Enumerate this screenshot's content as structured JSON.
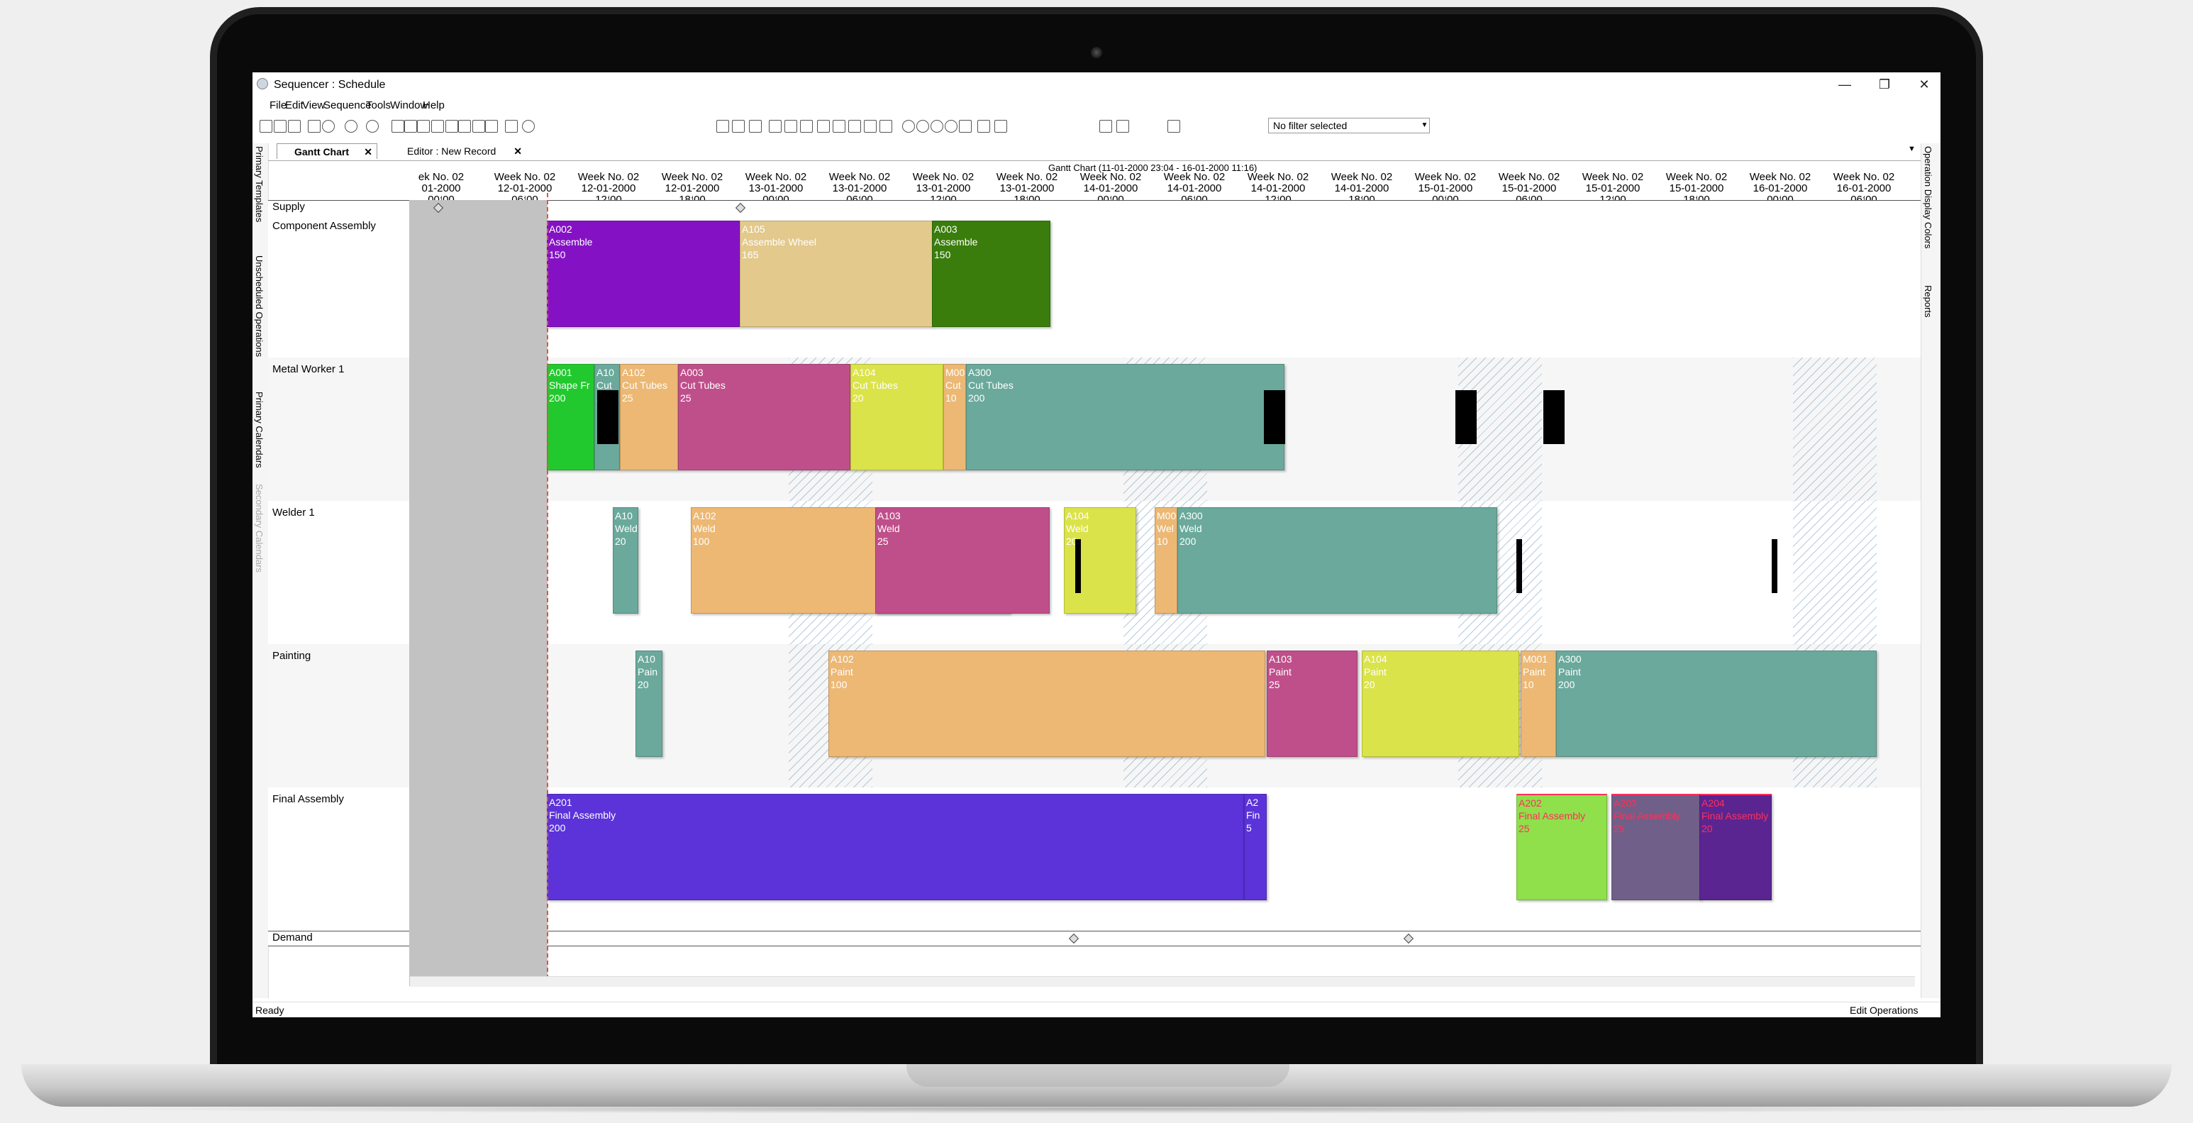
{
  "window": {
    "title": "Sequencer : Schedule",
    "min": "—",
    "max": "❐",
    "close": "✕"
  },
  "menu": [
    "File",
    "Edit",
    "View",
    "Sequence",
    "Tools",
    "Window",
    "Help"
  ],
  "toolbar": {
    "filter_value": "No filter selected"
  },
  "left_tabs": [
    "Primary Templates",
    "Unscheduled Operations",
    "Primary Calendars",
    "Secondary Calendars"
  ],
  "right_tabs": [
    "Operation Display Colors",
    "Reports"
  ],
  "doc_tabs": [
    {
      "label": "Gantt Chart",
      "active": true
    },
    {
      "label": "Editor : New Record",
      "active": false
    }
  ],
  "gantt": {
    "title": "Gantt Chart   (11-01-2000 23:04 - 16-01-2000 11:16)",
    "ticks": [
      {
        "week": "ek No. 02",
        "date": "01-2000",
        "time": "00:00"
      },
      {
        "week": "Week No. 02",
        "date": "12-01-2000",
        "time": "06:00"
      },
      {
        "week": "Week No. 02",
        "date": "12-01-2000",
        "time": "12:00"
      },
      {
        "week": "Week No. 02",
        "date": "12-01-2000",
        "time": "18:00"
      },
      {
        "week": "Week No. 02",
        "date": "13-01-2000",
        "time": "00:00"
      },
      {
        "week": "Week No. 02",
        "date": "13-01-2000",
        "time": "06:00"
      },
      {
        "week": "Week No. 02",
        "date": "13-01-2000",
        "time": "12:00"
      },
      {
        "week": "Week No. 02",
        "date": "13-01-2000",
        "time": "18:00"
      },
      {
        "week": "Week No. 02",
        "date": "14-01-2000",
        "time": "00:00"
      },
      {
        "week": "Week No. 02",
        "date": "14-01-2000",
        "time": "06:00"
      },
      {
        "week": "Week No. 02",
        "date": "14-01-2000",
        "time": "12:00"
      },
      {
        "week": "Week No. 02",
        "date": "14-01-2000",
        "time": "18:00"
      },
      {
        "week": "Week No. 02",
        "date": "15-01-2000",
        "time": "00:00"
      },
      {
        "week": "Week No. 02",
        "date": "15-01-2000",
        "time": "06:00"
      },
      {
        "week": "Week No. 02",
        "date": "15-01-2000",
        "time": "12:00"
      },
      {
        "week": "Week No. 02",
        "date": "15-01-2000",
        "time": "18:00"
      },
      {
        "week": "Week No. 02",
        "date": "16-01-2000",
        "time": "00:00"
      },
      {
        "week": "Week No. 02",
        "date": "16-01-2000",
        "time": "06:00"
      }
    ],
    "lanes": [
      "Supply",
      "Component Assembly",
      "Metal Worker 1",
      "Welder 1",
      "Painting",
      "Final Assembly",
      "Demand"
    ],
    "bars": [
      {
        "lane": "Component Assembly",
        "id": "A002",
        "op": "Assemble",
        "qty": "150",
        "color": "#8412c4"
      },
      {
        "lane": "Component Assembly",
        "id": "A105",
        "op": "Assemble Wheel",
        "qty": "165",
        "color": "#e3c98b"
      },
      {
        "lane": "Component Assembly",
        "id": "A003",
        "op": "Assemble",
        "qty": "150",
        "color": "#3a7d0c"
      },
      {
        "lane": "Metal Worker 1",
        "id": "A001",
        "op": "Shape Fr",
        "qty": "200",
        "color": "#22c92e"
      },
      {
        "lane": "Metal Worker 1",
        "id": "A10",
        "op": "Cut",
        "qty": "20",
        "color": "#6aa99b"
      },
      {
        "lane": "Metal Worker 1",
        "id": "A102",
        "op": "Cut Tubes",
        "qty": "25",
        "color": "#ecb874"
      },
      {
        "lane": "Metal Worker 1",
        "id": "A003",
        "op": "Cut Tubes",
        "qty": "25",
        "color": "#bf4f8a"
      },
      {
        "lane": "Metal Worker 1",
        "id": "A104",
        "op": "Cut Tubes",
        "qty": "20",
        "color": "#dbe34a"
      },
      {
        "lane": "Metal Worker 1",
        "id": "M00",
        "op": "Cut",
        "qty": "10",
        "color": "#ecb874"
      },
      {
        "lane": "Metal Worker 1",
        "id": "A300",
        "op": "Cut Tubes",
        "qty": "200",
        "color": "#6aa99b"
      },
      {
        "lane": "Welder 1",
        "id": "A10",
        "op": "Weld",
        "qty": "20",
        "color": "#6aa99b"
      },
      {
        "lane": "Welder 1",
        "id": "A102",
        "op": "Weld",
        "qty": "100",
        "color": "#ecb874"
      },
      {
        "lane": "Welder 1",
        "id": "A103",
        "op": "Weld",
        "qty": "25",
        "color": "#bf4f8a"
      },
      {
        "lane": "Welder 1",
        "id": "A104",
        "op": "Weld",
        "qty": "20",
        "color": "#dbe34a"
      },
      {
        "lane": "Welder 1",
        "id": "M00",
        "op": "Wel",
        "qty": "10",
        "color": "#ecb874"
      },
      {
        "lane": "Welder 1",
        "id": "A300",
        "op": "Weld",
        "qty": "200",
        "color": "#6aa99b"
      },
      {
        "lane": "Painting",
        "id": "A10",
        "op": "Pain",
        "qty": "20",
        "color": "#6aa99b"
      },
      {
        "lane": "Painting",
        "id": "A102",
        "op": "Paint",
        "qty": "100",
        "color": "#ecb874"
      },
      {
        "lane": "Painting",
        "id": "A103",
        "op": "Paint",
        "qty": "25",
        "color": "#bf4f8a"
      },
      {
        "lane": "Painting",
        "id": "A104",
        "op": "Paint",
        "qty": "20",
        "color": "#dbe34a"
      },
      {
        "lane": "Painting",
        "id": "M001",
        "op": "Paint",
        "qty": "10",
        "color": "#ecb874"
      },
      {
        "lane": "Painting",
        "id": "A300",
        "op": "Paint",
        "qty": "200",
        "color": "#6aa99b"
      },
      {
        "lane": "Final Assembly",
        "id": "A201",
        "op": "Final Assembly",
        "qty": "200",
        "color": "#5b33d8"
      },
      {
        "lane": "Final Assembly",
        "id": "A2",
        "op": "Fin",
        "qty": "5",
        "color": "#5b33d8"
      },
      {
        "lane": "Final Assembly",
        "id": "A202",
        "op": "Final Assembly",
        "qty": "25",
        "color": "#8fe04a",
        "red": true
      },
      {
        "lane": "Final Assembly",
        "id": "A203",
        "op": "Final Assembly",
        "qty": "25",
        "color": "#705f88",
        "red": true
      },
      {
        "lane": "Final Assembly",
        "id": "A204",
        "op": "Final Assembly",
        "qty": "20",
        "color": "#5a2590",
        "red": true
      }
    ]
  },
  "status": {
    "left": "Ready",
    "right": "Edit Operations"
  }
}
